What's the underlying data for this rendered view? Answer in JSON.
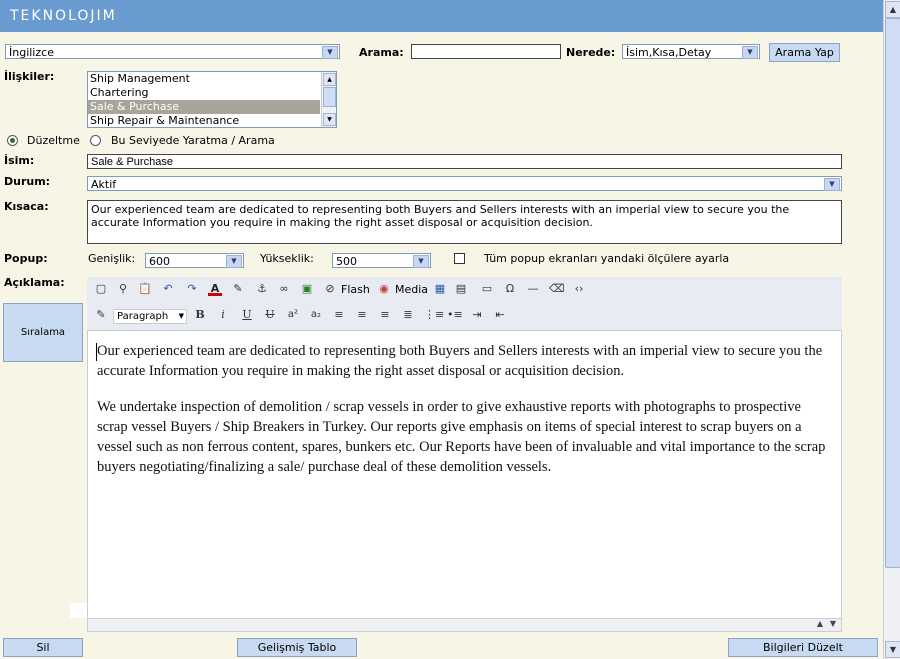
{
  "app": {
    "logo": "TEKNOLOJIM"
  },
  "top": {
    "language": "İngilizce",
    "search_label": "Arama:",
    "search_value": "",
    "where_label": "Nerede:",
    "where_value": "İsim,Kısa,Detay",
    "search_button": "Arama Yap"
  },
  "relations": {
    "label": "İlişkiler:",
    "items": [
      "Ship Management",
      "Chartering",
      "Sale & Purchase",
      "Ship Repair & Maintenance"
    ],
    "selected": "Sale & Purchase"
  },
  "mode": {
    "edit_label": "Düzeltme",
    "create_label": "Bu Seviyede Yaratma / Arama",
    "selected": "edit"
  },
  "name": {
    "label": "İsim:",
    "value": "Sale & Purchase"
  },
  "status": {
    "label": "Durum:",
    "value": "Aktif"
  },
  "summary": {
    "label": "Kısaca:",
    "value": "Our experienced team are dedicated to representing both Buyers and Sellers interests with an imperial view to secure you the accurate Information you require in making the right asset disposal or acquisition decision."
  },
  "popup": {
    "label": "Popup:",
    "width_label": "Genişlik:",
    "width_value": "600",
    "height_label": "Yükseklik:",
    "height_value": "500",
    "checkbox_label": "Tüm popup ekranları yandaki ölçülere ayarla",
    "checked": false
  },
  "description": {
    "label": "Açıklama:"
  },
  "editor": {
    "toolbar": {
      "flash": "Flash",
      "media": "Media",
      "format": "Paragraph"
    },
    "paragraphs": [
      "Our experienced team are dedicated to representing both Buyers and Sellers interests with an imperial view to secure you the accurate Information you require in making the right asset disposal or acquisition decision.",
      "We undertake inspection of demolition / scrap vessels in order to give exhaustive reports with photographs to prospective scrap vessel Buyers / Ship Breakers in Turkey. Our reports give emphasis on items of special interest to scrap buyers on a vessel such as non ferrous content, spares, bunkers etc. Our Reports have been of invaluable and vital importance to the scrap buyers negotiating/finalizing a sale/ purchase deal of these demolition vessels."
    ]
  },
  "buttons": {
    "sort": "Sıralama",
    "delete": "Sil",
    "advanced_table": "Gelişmiş Tablo",
    "update": "Bilgileri Düzelt"
  }
}
